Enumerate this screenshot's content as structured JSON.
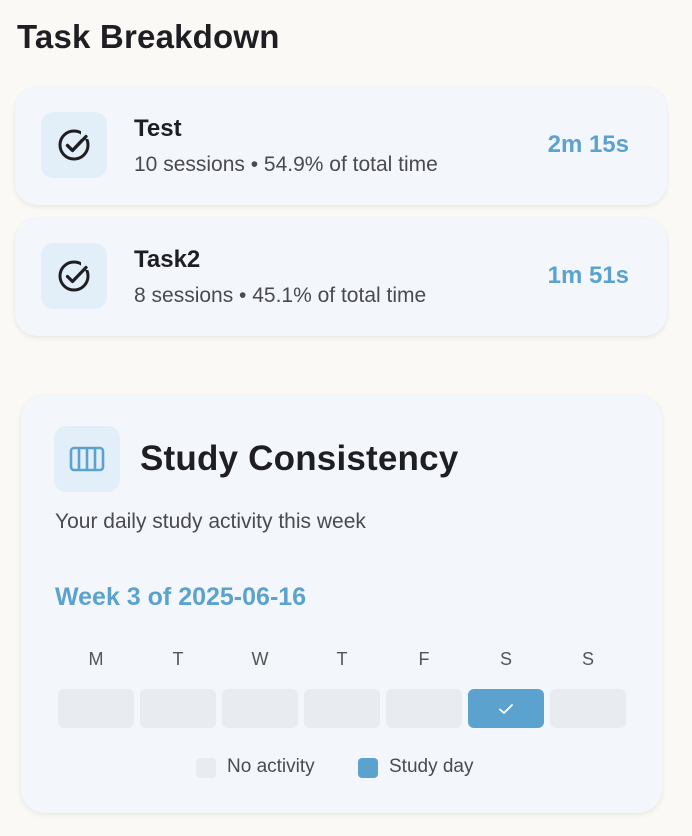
{
  "header": {
    "title": "Task Breakdown"
  },
  "tasks": [
    {
      "name": "Test",
      "meta": "10 sessions • 54.9% of total time",
      "time": "2m 15s",
      "icon": "check-circle-icon"
    },
    {
      "name": "Task2",
      "meta": "8 sessions • 45.1% of total time",
      "time": "1m 51s",
      "icon": "check-circle-icon"
    }
  ],
  "consistency": {
    "icon": "calendar-bars-icon",
    "title": "Study Consistency",
    "subtitle": "Your daily study activity this week",
    "week_label": "Week 3 of 2025-06-16",
    "days": [
      {
        "letter": "M",
        "studied": false
      },
      {
        "letter": "T",
        "studied": false
      },
      {
        "letter": "W",
        "studied": false
      },
      {
        "letter": "T",
        "studied": false
      },
      {
        "letter": "F",
        "studied": false
      },
      {
        "letter": "S",
        "studied": true
      },
      {
        "letter": "S",
        "studied": false
      }
    ],
    "legend": {
      "no_activity": "No activity",
      "study_day": "Study day"
    }
  },
  "colors": {
    "accent": "#5ba2cf",
    "empty_day": "#e8ecf0",
    "card_bg": "#f3f7fb",
    "icon_bg": "#e3eff8"
  }
}
